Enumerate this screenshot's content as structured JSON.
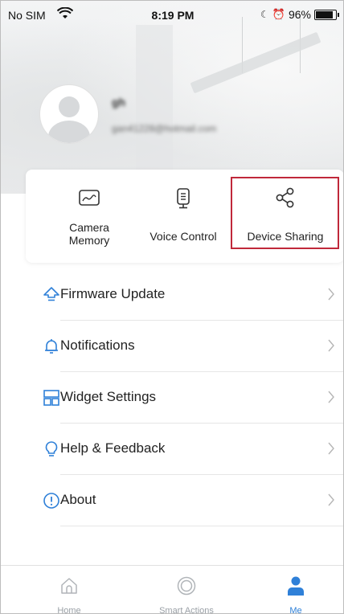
{
  "status_bar": {
    "carrier": "No SIM",
    "time": "8:19 PM",
    "battery": "96%",
    "battery_level": 0.96
  },
  "profile": {
    "name": "gh",
    "email": "gan41228@hotmail.com"
  },
  "quick_actions": [
    {
      "label": "Camera\nMemory",
      "icon": "camera-memory-icon"
    },
    {
      "label": "Voice Control",
      "icon": "voice-control-icon"
    },
    {
      "label": "Device Sharing",
      "icon": "share-icon"
    }
  ],
  "menu": [
    {
      "label": "Firmware Update",
      "icon": "firmware-update-icon"
    },
    {
      "label": "Notifications",
      "icon": "bell-icon"
    },
    {
      "label": "Widget Settings",
      "icon": "widget-icon"
    },
    {
      "label": "Help & Feedback",
      "icon": "lightbulb-icon"
    },
    {
      "label": "About",
      "icon": "info-icon"
    }
  ],
  "tabs": [
    {
      "label": "Home",
      "icon": "home-icon",
      "active": false
    },
    {
      "label": "Smart Actions",
      "icon": "smart-actions-icon",
      "active": false
    },
    {
      "label": "Me",
      "icon": "person-icon",
      "active": true
    }
  ],
  "colors": {
    "accent": "#2f80d8",
    "highlight": "#c0283a",
    "icon": "#333333"
  }
}
